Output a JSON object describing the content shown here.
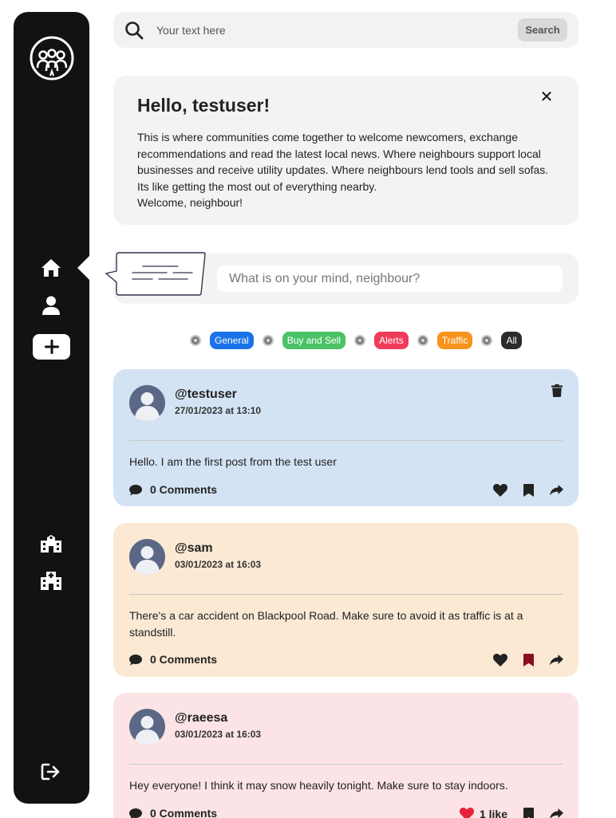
{
  "search": {
    "placeholder": "Your text here",
    "button_label": "Search"
  },
  "welcome": {
    "title": "Hello, testuser!",
    "close_glyph": "✕",
    "lines": [
      "This is where communities come together to welcome newcomers, exchange recommendations and read the latest local news. Where neighbours support local businesses and receive utility updates. Where neighbours lend tools and sell sofas. Its like getting the most out of everything nearby.",
      "Welcome, neighbour!"
    ]
  },
  "compose": {
    "placeholder": "What is on your mind, neighbour?"
  },
  "filters": [
    {
      "label": "General",
      "color": "#1a73e8"
    },
    {
      "label": "Buy and Sell",
      "color": "#4cc267"
    },
    {
      "label": "Alerts",
      "color": "#f03c5a"
    },
    {
      "label": "Traffic",
      "color": "#f7941d"
    },
    {
      "label": "All",
      "color": "#2b2b2b"
    }
  ],
  "sidebar": {
    "icons": [
      "community-logo-icon",
      "home-icon",
      "user-icon",
      "plus-icon",
      "school-icon",
      "hospital-icon",
      "logout-icon"
    ]
  },
  "posts": [
    {
      "username": "@testuser",
      "timestamp": "27/01/2023 at 13:10",
      "text": "Hello. I am the first post from the test user",
      "comments": "0 Comments",
      "likes": "",
      "bg": "#d4e3f4",
      "bookmarked": false,
      "liked": false,
      "deletable": true
    },
    {
      "username": "@sam",
      "timestamp": "03/01/2023 at 16:03",
      "text": "There's a car accident on Blackpool Road. Make sure to avoid it as traffic is at a standstill.",
      "comments": "0 Comments",
      "likes": "",
      "bg": "#fbe9d4",
      "bookmarked": true,
      "liked": false,
      "deletable": false
    },
    {
      "username": "@raeesa",
      "timestamp": "03/01/2023 at 16:03",
      "text": "Hey everyone! I think it may snow heavily tonight. Make sure to stay indoors.",
      "comments": "0 Comments",
      "likes": "1 like",
      "bg": "#fce4e6",
      "bookmarked": false,
      "liked": true,
      "deletable": false
    }
  ]
}
